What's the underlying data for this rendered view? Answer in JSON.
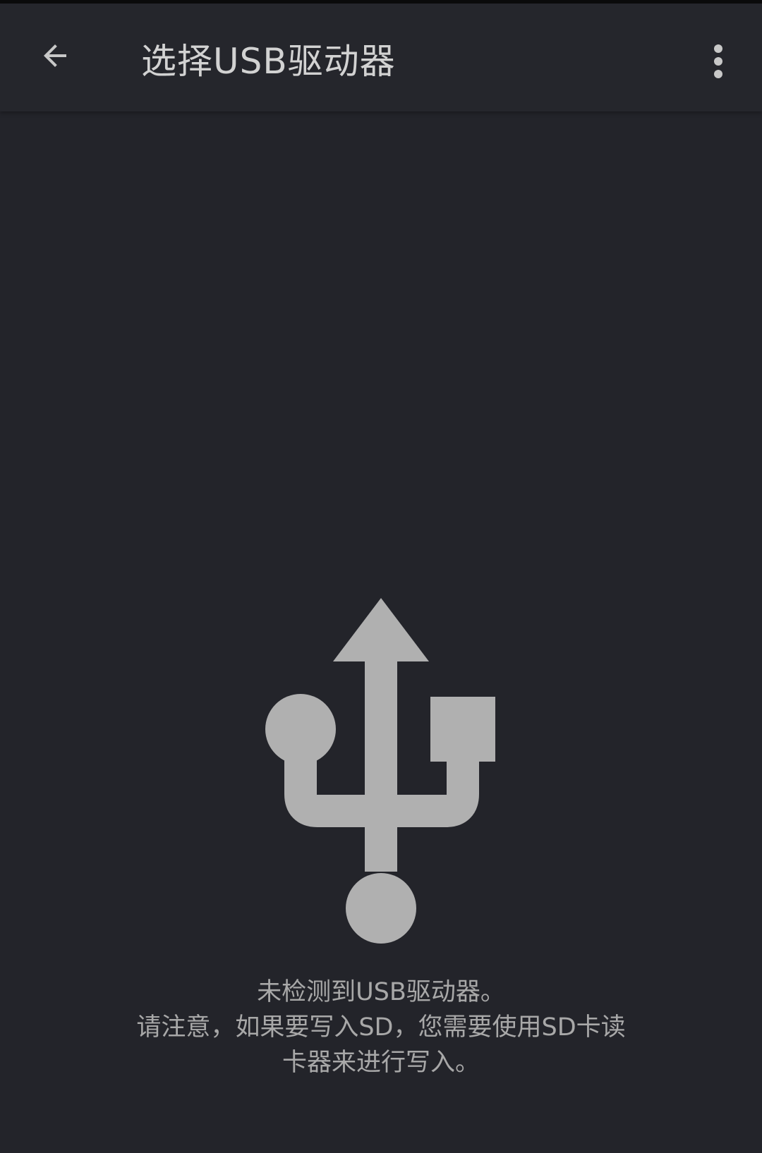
{
  "app_bar": {
    "title": "选择USB驱动器",
    "back_icon": "arrow-back-icon",
    "overflow_icon": "more-vert-icon"
  },
  "empty_state": {
    "icon": "usb-icon",
    "line1": "未检测到USB驱动器。",
    "line2": "请注意，如果要写入SD，您需要使用SD卡读",
    "line3": "卡器来进行写入。"
  },
  "colors": {
    "background": "#23242a",
    "app_bar": "#25262c",
    "icon": "#b0b0b0",
    "title_text": "#d2d2d2",
    "body_text": "#a8a8a8"
  }
}
